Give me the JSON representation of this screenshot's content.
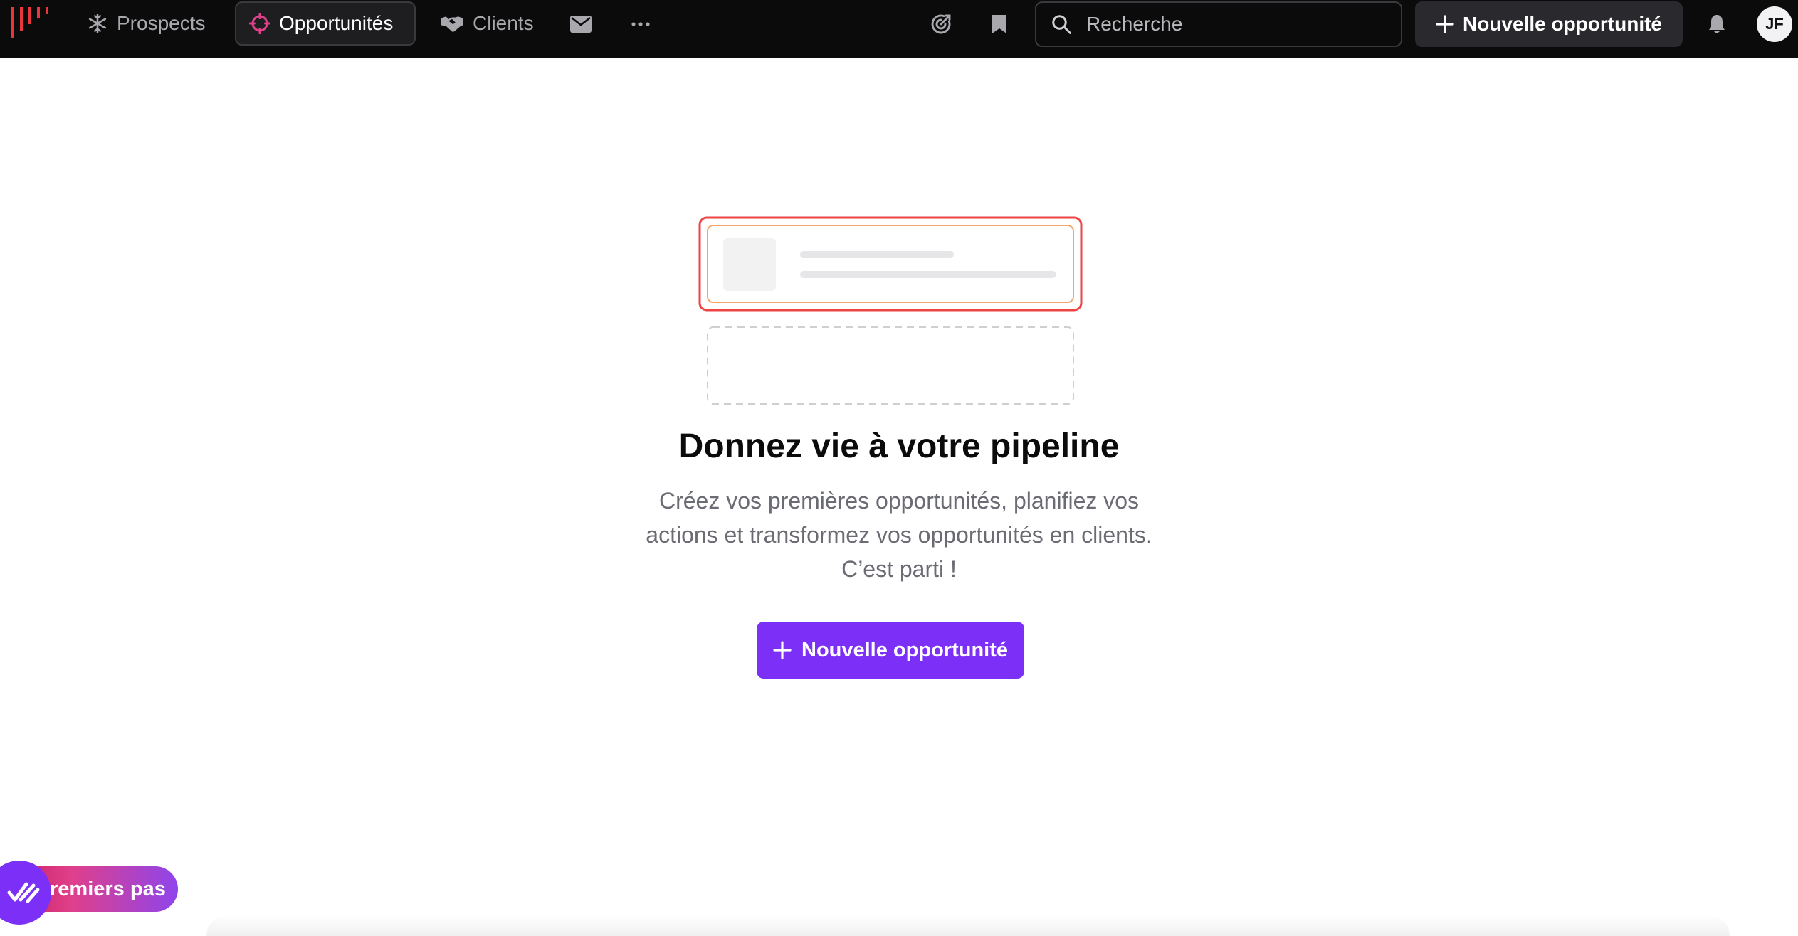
{
  "nav": {
    "items": [
      {
        "label": "Prospects",
        "icon": "snowflake-icon",
        "active": false
      },
      {
        "label": "Opportunités",
        "icon": "target-icon",
        "active": true
      },
      {
        "label": "Clients",
        "icon": "handshake-icon",
        "active": false
      }
    ],
    "mail_icon": "mail-icon",
    "more_icon": "more-horizontal-icon",
    "goals_icon": "target-check-icon",
    "bookmark_icon": "bookmark-icon",
    "search": {
      "placeholder": "Recherche",
      "value": ""
    },
    "new_opportunity_label": "Nouvelle opportunité",
    "bell_icon": "bell-icon",
    "avatar_initials": "JF"
  },
  "empty_state": {
    "title": "Donnez vie à votre pipeline",
    "description_lines": [
      "Créez vos premières opportunités, planifiez vos",
      "actions et transformez vos opportunités en clients.",
      "C’est parti !"
    ],
    "cta_label": "Nouvelle opportunité"
  },
  "onboarding": {
    "label": "remiers pas",
    "icon": "double-check-icon"
  },
  "colors": {
    "topbar": "#0b0b0c",
    "accent_purple": "#7b2ff7",
    "accent_red": "#ef4444",
    "accent_orange": "#f6a56a",
    "logo_red": "#e8373a"
  }
}
